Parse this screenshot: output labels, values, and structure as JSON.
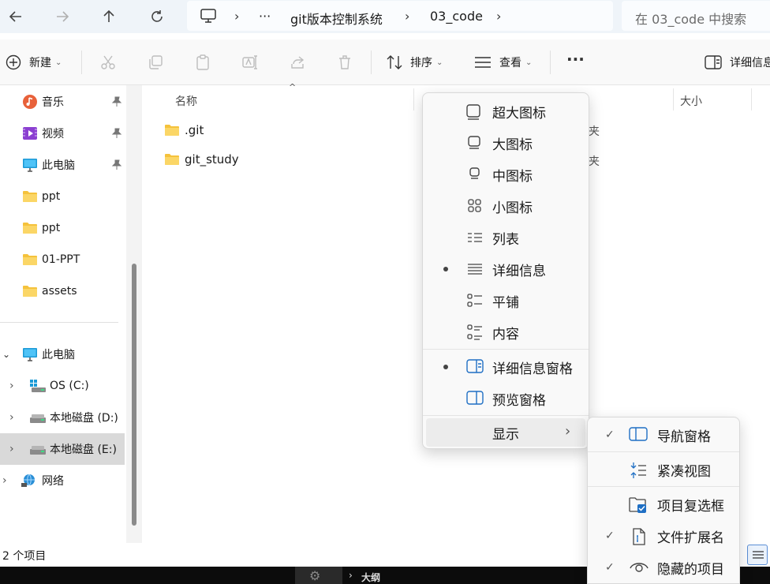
{
  "address_bar": {
    "breadcrumb": [
      "git版本控制系统",
      "03_code"
    ],
    "ellipsis": "···",
    "search_placeholder": "在 03_code 中搜索"
  },
  "toolbar": {
    "new_label": "新建",
    "sort_label": "排序",
    "view_label": "查看",
    "more_label": "···",
    "details_label": "详细信息"
  },
  "sidebar": {
    "quick_items": [
      {
        "label": "音乐",
        "icon": "music-icon",
        "pinned": true
      },
      {
        "label": "视频",
        "icon": "video-icon",
        "pinned": true
      },
      {
        "label": "此电脑",
        "icon": "monitor-icon",
        "pinned": true
      },
      {
        "label": "ppt",
        "icon": "folder-icon"
      },
      {
        "label": "ppt",
        "icon": "folder-icon"
      },
      {
        "label": "01-PPT",
        "icon": "folder-icon"
      },
      {
        "label": "assets",
        "icon": "folder-icon"
      }
    ],
    "this_pc": "此电脑",
    "drives": [
      "OS (C:)",
      "本地磁盘 (D:)",
      "本地磁盘 (E:)"
    ],
    "network": "网络"
  },
  "columns": {
    "name": "名称",
    "size": "大小"
  },
  "files": [
    {
      "name": ".git",
      "type_partial": "夹"
    },
    {
      "name": "git_study",
      "type_partial": "夹"
    }
  ],
  "status": {
    "item_count": "2 个项目"
  },
  "view_menu": {
    "items": [
      {
        "label": "超大图标",
        "icon": "extra-large-icons-icon"
      },
      {
        "label": "大图标",
        "icon": "large-icons-icon"
      },
      {
        "label": "中图标",
        "icon": "medium-icons-icon"
      },
      {
        "label": "小图标",
        "icon": "small-icons-icon"
      },
      {
        "label": "列表",
        "icon": "list-view-icon"
      },
      {
        "label": "详细信息",
        "icon": "details-view-icon",
        "selected": true
      },
      {
        "label": "平铺",
        "icon": "tiles-view-icon"
      },
      {
        "label": "内容",
        "icon": "content-view-icon"
      }
    ],
    "panes": [
      {
        "label": "详细信息窗格",
        "icon": "details-pane-icon",
        "selected": true
      },
      {
        "label": "预览窗格",
        "icon": "preview-pane-icon"
      }
    ],
    "show_label": "显示"
  },
  "show_submenu": {
    "items": [
      {
        "label": "导航窗格",
        "checked": true
      },
      {
        "label": "紧凑视图",
        "checked": false
      },
      {
        "label": "项目复选框",
        "checked": false
      },
      {
        "label": "文件扩展名",
        "checked": true
      },
      {
        "label": "隐藏的项目",
        "checked": true
      }
    ]
  },
  "taskbar": {
    "outline_label": "大纲"
  }
}
